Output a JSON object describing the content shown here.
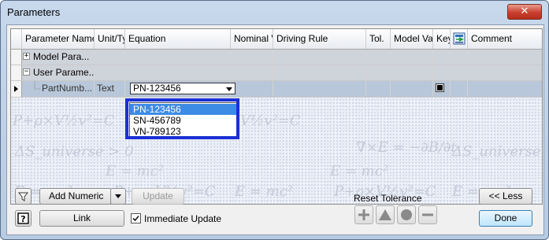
{
  "window": {
    "title": "Parameters",
    "close_glyph": "✕"
  },
  "grid": {
    "columns": [
      "Parameter Name",
      "Unit/Ty",
      "Equation",
      "Nominal V",
      "Driving Rule",
      "Tol.",
      "Model Val",
      "Key",
      "",
      "Comment"
    ],
    "export_column_icon": "export-parameter-icon",
    "groups": [
      {
        "expander": "+",
        "label": "Model Para..."
      },
      {
        "expander": "−",
        "label": "User Parame..."
      }
    ],
    "selected_row": {
      "name": "PartNumb...",
      "unit": "Text",
      "equation": "PN-123456",
      "key_checked": true
    },
    "dropdown_options": [
      "PN-123456",
      "SN-456789",
      "VN-789123"
    ],
    "dropdown_selected_index": 0,
    "background_formulas": [
      "P+ρ×V½v²=C",
      "ΔS_universe > 0",
      "∇×E = −∂B/∂t",
      "E = mc²"
    ]
  },
  "footer": {
    "add_numeric_label": "Add Numeric",
    "update_label": "Update",
    "link_label": "Link",
    "immediate_update_label": "Immediate Update",
    "immediate_update_checked": true,
    "reset_tolerance_label": "Reset Tolerance",
    "less_label": "<< Less",
    "done_label": "Done",
    "filter_icon": "filter-icon",
    "help_icon": "help-icon",
    "tolerance_icons": [
      "plus-tolerance-icon",
      "upper-tolerance-icon",
      "median-tolerance-icon",
      "lower-tolerance-icon"
    ]
  },
  "colors": {
    "highlight_border": "#1b2fd6",
    "selected_option": "#3c8ce6",
    "selected_row": "#b8c7d9"
  }
}
